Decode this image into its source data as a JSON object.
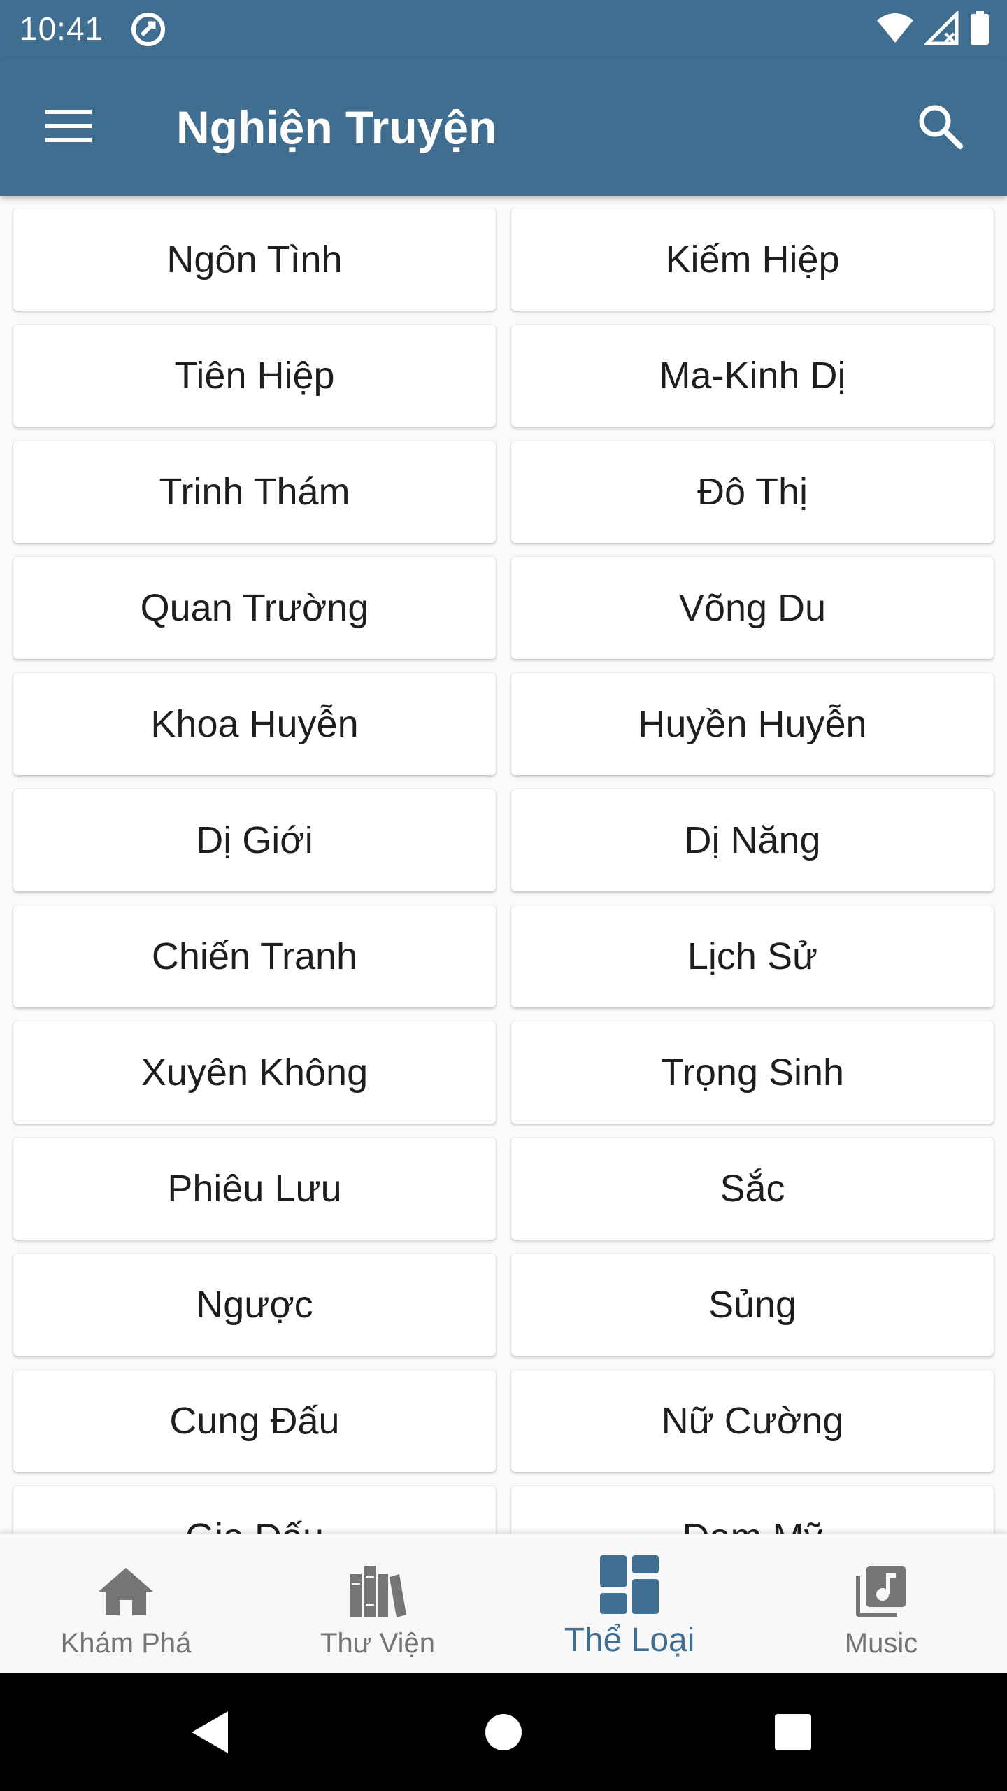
{
  "status_bar": {
    "time": "10:41",
    "icons": [
      "sync-icon",
      "wifi-icon",
      "signal-icon",
      "battery-icon"
    ]
  },
  "app_bar": {
    "title": "Nghiện Truyện",
    "menu_icon": "hamburger-menu-icon",
    "search_icon": "search-icon"
  },
  "categories": [
    "Ngôn Tình",
    "Kiếm Hiệp",
    "Tiên Hiệp",
    "Ma-Kinh Dị",
    "Trinh Thám",
    "Đô Thị",
    "Quan Trường",
    "Võng Du",
    "Khoa Huyễn",
    "Huyền Huyễn",
    "Dị Giới",
    "Dị Năng",
    "Chiến Tranh",
    "Lịch Sử",
    "Xuyên Không",
    "Trọng Sinh",
    "Phiêu Lưu",
    "Sắc",
    "Ngược",
    "Sủng",
    "Cung Đấu",
    "Nữ Cường",
    "Gia Đấu",
    "Đam Mỹ"
  ],
  "bottom_nav": {
    "items": [
      {
        "label": "Khám Phá",
        "icon": "home-icon",
        "active": false
      },
      {
        "label": "Thư Viện",
        "icon": "library-icon",
        "active": false
      },
      {
        "label": "Thể Loại",
        "icon": "dashboard-icon",
        "active": true
      },
      {
        "label": "Music",
        "icon": "music-library-icon",
        "active": false
      }
    ]
  },
  "colors": {
    "primary": "#3f6e91",
    "inactive": "#757575",
    "background": "#fafafa"
  }
}
